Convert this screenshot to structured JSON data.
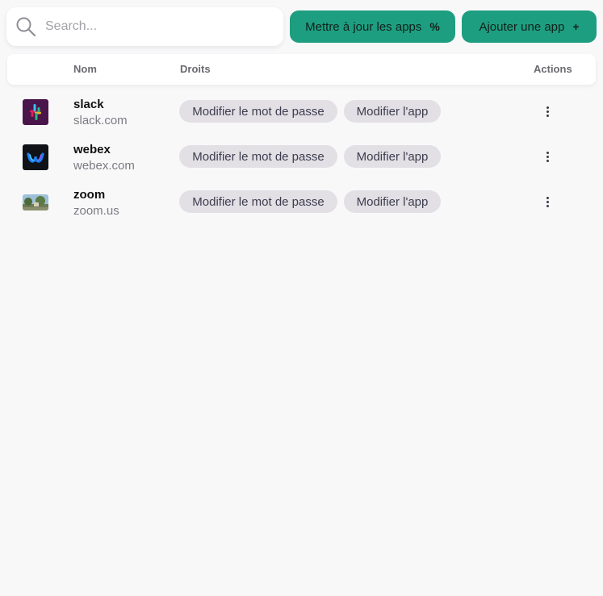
{
  "search": {
    "placeholder": "Search..."
  },
  "toolbar": {
    "update_label": "Mettre à jour les apps",
    "update_icon": "percent-icon",
    "add_label": "Ajouter une app",
    "add_icon": "plus-icon"
  },
  "table": {
    "headers": {
      "name": "Nom",
      "rights": "Droits",
      "actions": "Actions"
    },
    "rows": [
      {
        "name": "slack",
        "domain": "slack.com",
        "icon": "slack-logo-icon",
        "rights": [
          "Modifier le mot de passe",
          "Modifier l'app"
        ]
      },
      {
        "name": "webex",
        "domain": "webex.com",
        "icon": "webex-logo-icon",
        "rights": [
          "Modifier le mot de passe",
          "Modifier l'app"
        ]
      },
      {
        "name": "zoom",
        "domain": "zoom.us",
        "icon": "zoom-thumbnail-icon",
        "rights": [
          "Modifier le mot de passe",
          "Modifier l'app"
        ]
      }
    ]
  },
  "colors": {
    "accent": "#1e9e80",
    "tag_bg": "#e2dfe5",
    "background": "#f8f8f9"
  }
}
